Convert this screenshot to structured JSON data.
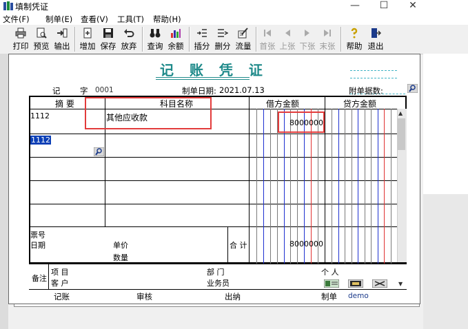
{
  "window": {
    "title": "填制凭证",
    "minimize": "—",
    "maximize": "☐",
    "close": "✕"
  },
  "menu": [
    "文件(F)",
    "制单(E)",
    "查看(V)",
    "工具(T)",
    "帮助(H)"
  ],
  "toolbar": [
    {
      "label": "打印",
      "icon": "printer-icon",
      "enabled": true
    },
    {
      "label": "预览",
      "icon": "preview-icon",
      "enabled": true
    },
    {
      "label": "输出",
      "icon": "export-icon",
      "enabled": true
    },
    {
      "label": "增加",
      "icon": "add-icon",
      "enabled": true
    },
    {
      "label": "保存",
      "icon": "save-icon",
      "enabled": true
    },
    {
      "label": "放弃",
      "icon": "undo-icon",
      "enabled": true
    },
    {
      "label": "查询",
      "icon": "binoculars-icon",
      "enabled": true
    },
    {
      "label": "余额",
      "icon": "balance-chart-icon",
      "enabled": true
    },
    {
      "label": "插分",
      "icon": "insert-line-icon",
      "enabled": true
    },
    {
      "label": "删分",
      "icon": "delete-line-icon",
      "enabled": true
    },
    {
      "label": "流量",
      "icon": "cashflow-icon",
      "enabled": true
    },
    {
      "label": "首张",
      "icon": "first-icon",
      "enabled": false
    },
    {
      "label": "上张",
      "icon": "prev-icon",
      "enabled": false
    },
    {
      "label": "下张",
      "icon": "next-icon",
      "enabled": false
    },
    {
      "label": "末张",
      "icon": "last-icon",
      "enabled": false
    },
    {
      "label": "帮助",
      "icon": "help-icon",
      "enabled": true
    },
    {
      "label": "退出",
      "icon": "exit-icon",
      "enabled": true
    }
  ],
  "voucher": {
    "title": "记 账 凭 证",
    "type_label": "记",
    "number_label": "字",
    "number": "0001",
    "date_label": "制单日期:",
    "date": "2021.07.13",
    "attachments_label": "附单据数:",
    "columns": {
      "summary": "摘 要",
      "account": "科目名称",
      "debit": "借方金额",
      "credit": "贷方金额"
    },
    "rows": [
      {
        "summary": "1112",
        "account": "其他应收款",
        "debit": "8000000",
        "credit": ""
      },
      {
        "summary": "1112",
        "account": "",
        "debit": "",
        "credit": ""
      }
    ],
    "bottom": {
      "ticket_no": "票号",
      "date": "日期",
      "unit_price": "单价",
      "quantity": "数量",
      "total_label": "合 计",
      "total_debit": "8000000"
    },
    "remarks": {
      "label": "备注",
      "project": "项 目",
      "customer": "客 户",
      "department": "部 门",
      "salesperson": "业务员",
      "personal": "个 人"
    },
    "footer": {
      "posting": "记账",
      "review": "审核",
      "cashier": "出纳",
      "maker_label": "制单",
      "maker": "demo"
    }
  },
  "colors": {
    "accent": "#1f8a8a",
    "highlight": "#e23b3b",
    "debit_line": "#1c2fd0",
    "credit_line": "#e03030"
  }
}
